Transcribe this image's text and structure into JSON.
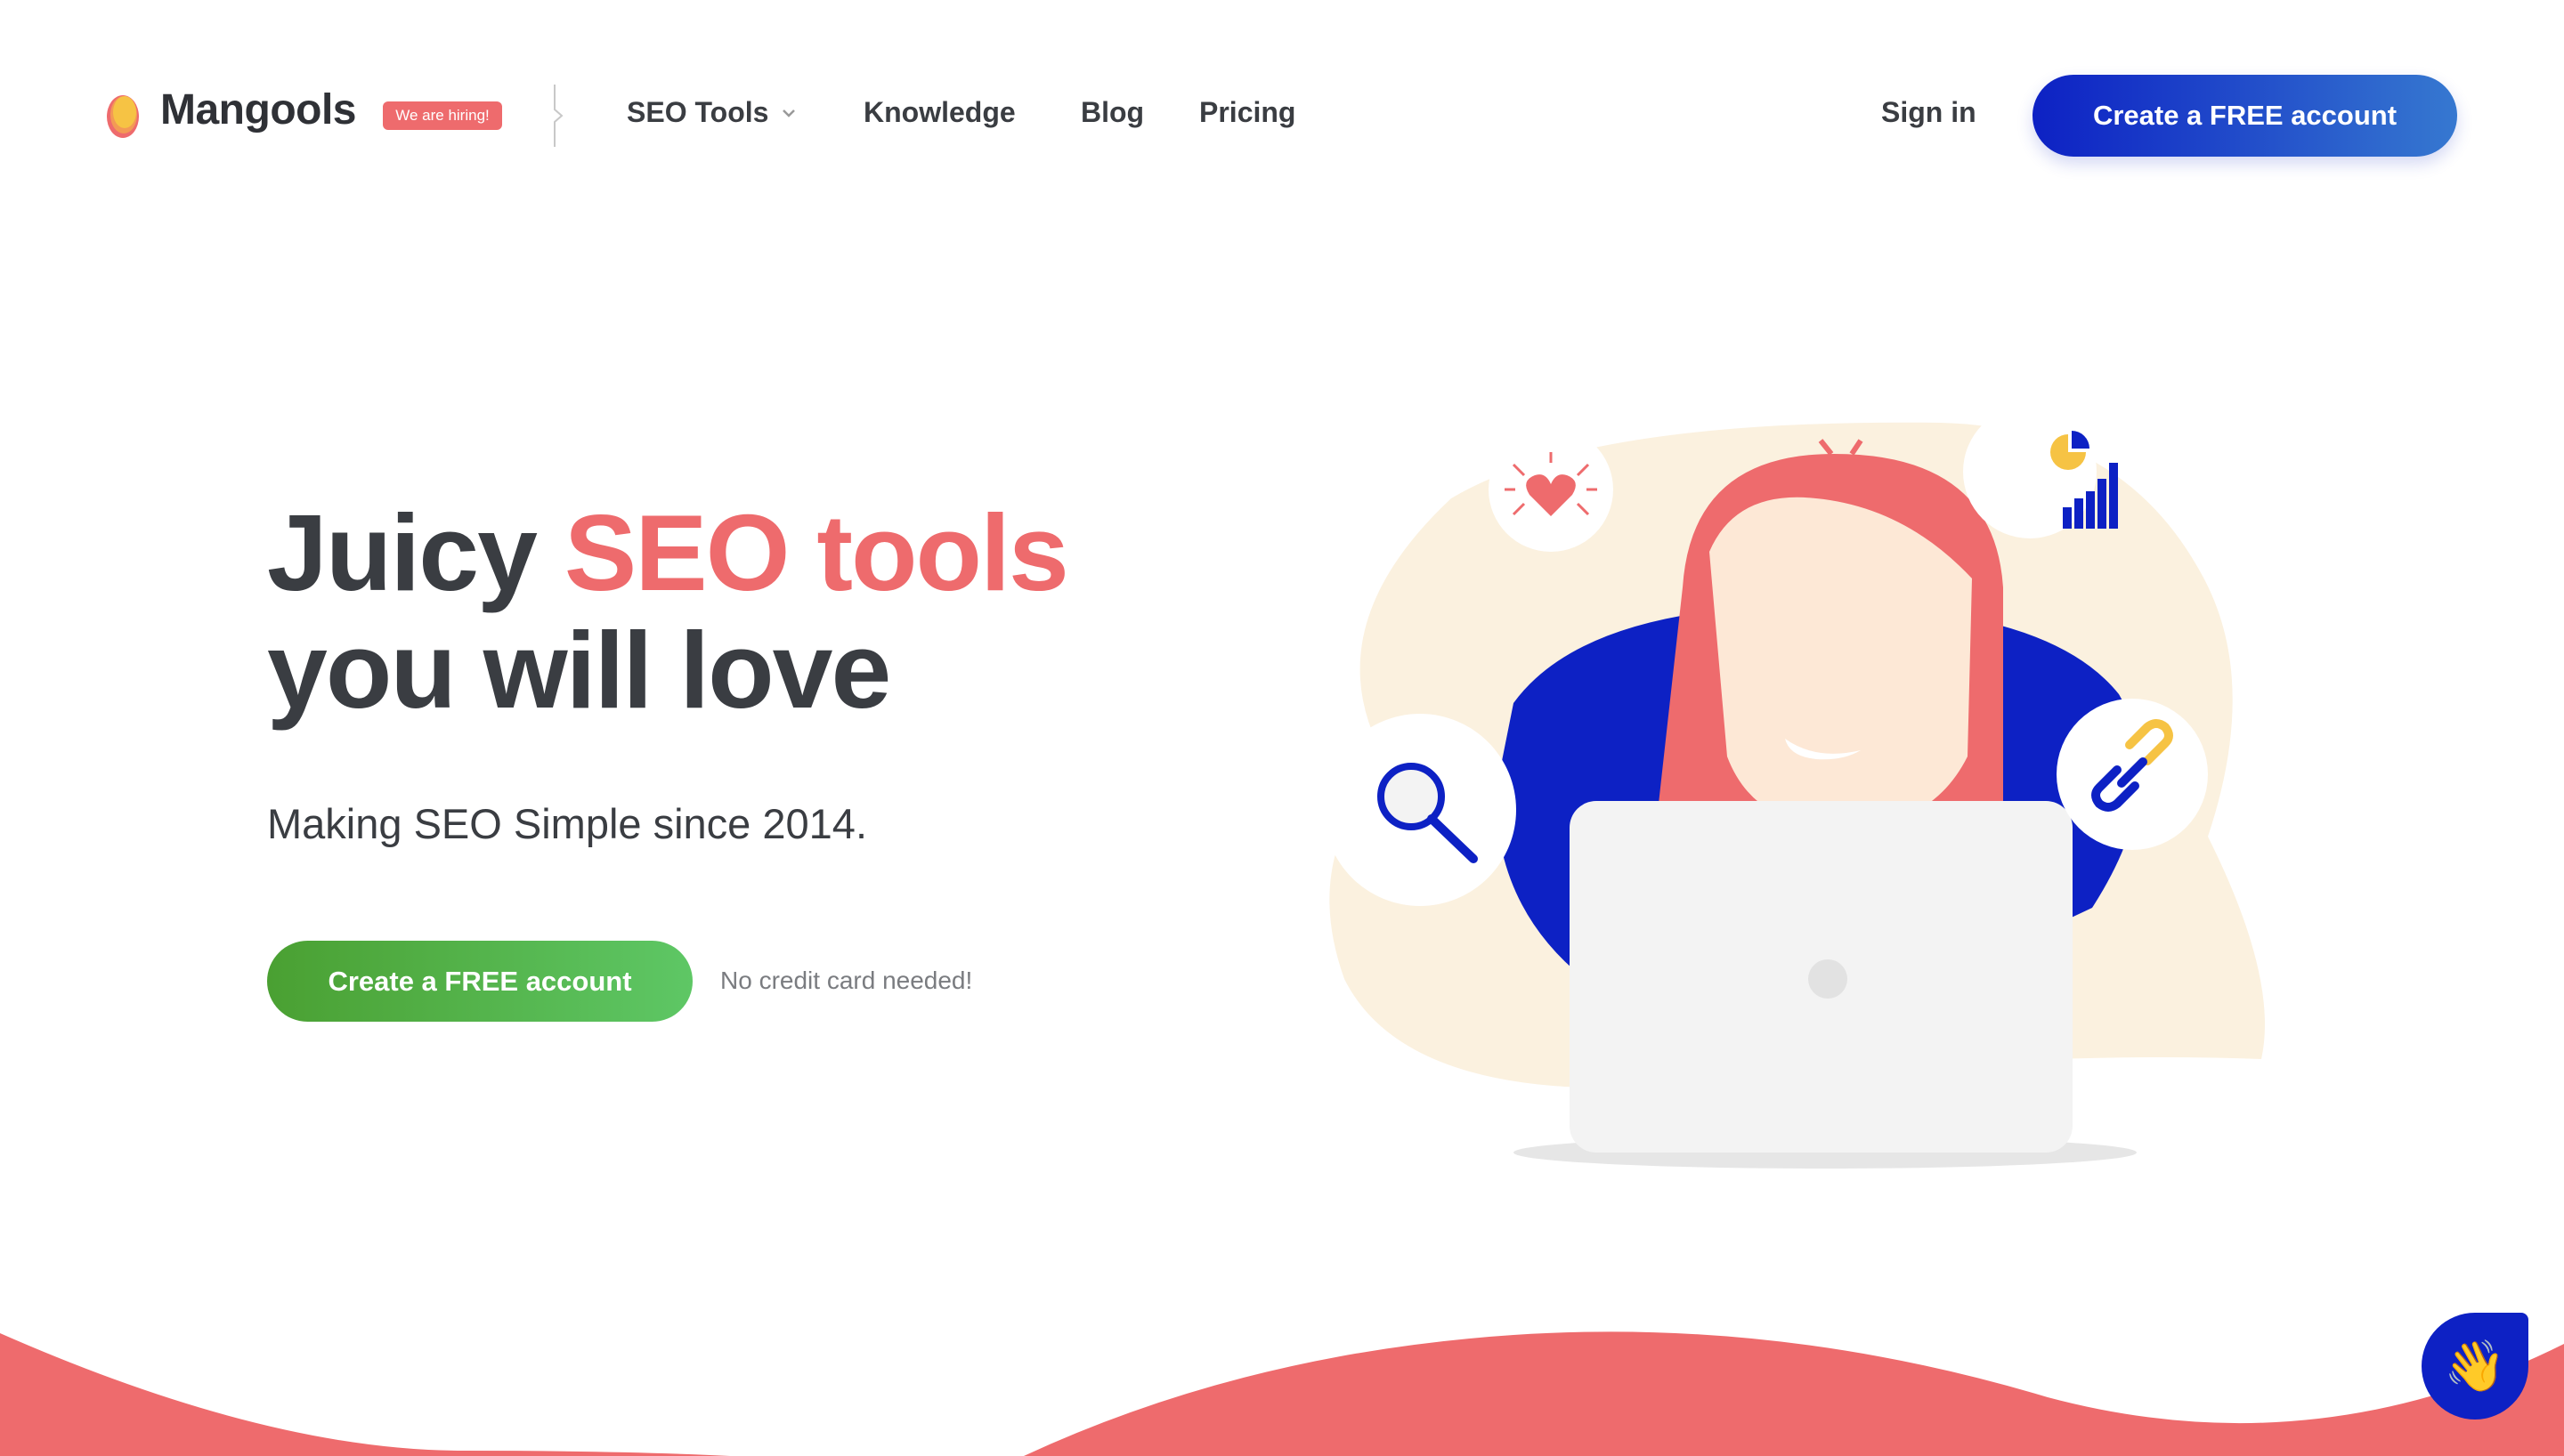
{
  "header": {
    "logo_text": "Mangools",
    "hiring_badge": "We are hiring!",
    "nav": [
      {
        "label": "SEO Tools",
        "has_dropdown": true
      },
      {
        "label": "Knowledge"
      },
      {
        "label": "Blog"
      },
      {
        "label": "Pricing"
      }
    ],
    "sign_in": "Sign in",
    "cta": "Create a FREE account"
  },
  "hero": {
    "title_part1": "Juicy ",
    "title_accent": "SEO tools",
    "title_line2": "you will love",
    "subtitle": "Making SEO Simple since 2014.",
    "cta": "Create a FREE account",
    "note": "No credit card needed!"
  },
  "colors": {
    "accent": "#ee6b6d",
    "primary_blue": "#0d21c4",
    "green": "#4aa032"
  },
  "chat": {
    "icon": "waving-hand-icon"
  }
}
